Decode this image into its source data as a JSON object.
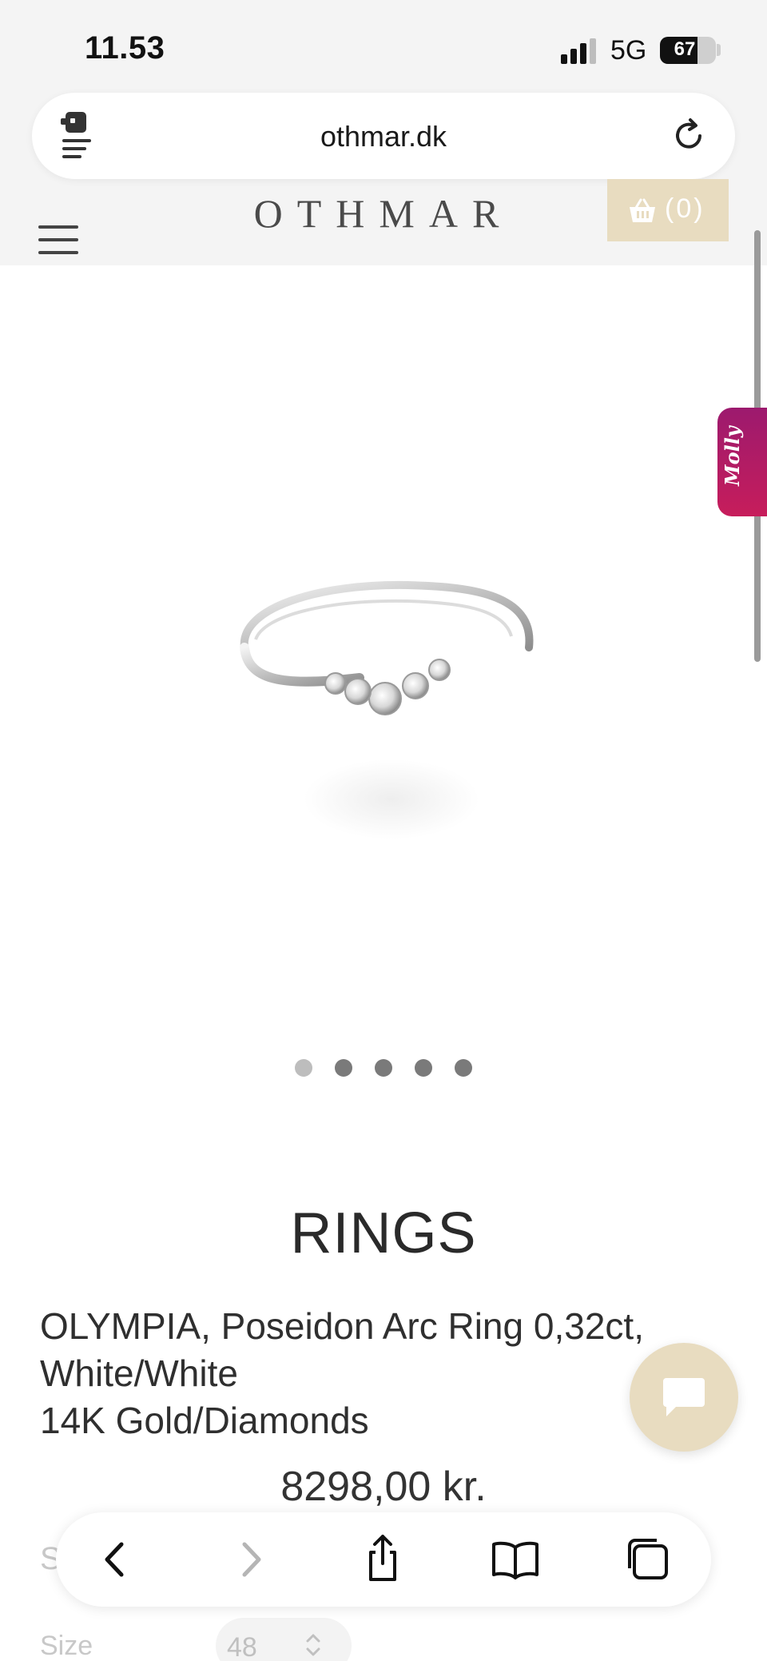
{
  "status_bar": {
    "time": "11.53",
    "network": "5G",
    "battery": "67",
    "battery_level": 0.67
  },
  "browser": {
    "url": "othmar.dk",
    "left_icon": "page-menu-icon",
    "reload_icon": "reload-icon"
  },
  "site_header": {
    "logo": "OTHMAR",
    "cart_count": "(0)",
    "menu_icon": "hamburger-menu-icon",
    "cart_icon": "shopping-basket-icon"
  },
  "molly": {
    "label": "Molly"
  },
  "carousel": {
    "total": 5,
    "active_index": 0
  },
  "product": {
    "category": "RINGS",
    "name_line1": "OLYMPIA, Poseidon Arc Ring 0,32ct,",
    "name_line2": "White/White",
    "name_line3": "14K Gold/Diamonds",
    "price": "8298,00 kr."
  },
  "hidden_content": {
    "partial_letter": "S",
    "size_label": "Size",
    "size_value": "48"
  },
  "toolbar": {
    "icons": [
      "back-icon",
      "forward-icon",
      "share-icon",
      "bookmarks-icon",
      "tabs-icon"
    ]
  },
  "colors": {
    "accent_beige": "#e8dcc0",
    "molly_gradient_start": "#9c1a6e",
    "molly_gradient_end": "#c71d5b",
    "chrome_bg": "#f4f4f4"
  }
}
